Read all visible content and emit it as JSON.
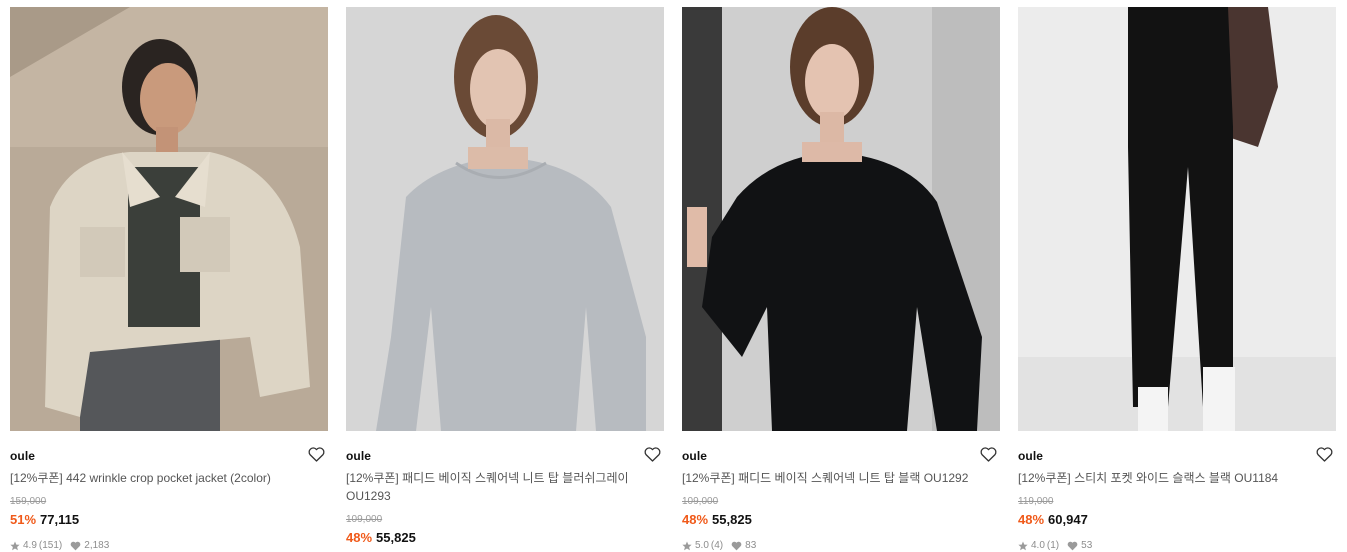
{
  "products": [
    {
      "brand": "oule",
      "title": "[12%쿠폰] 442 wrinkle crop pocket jacket (2color)",
      "original_price": "159,000",
      "discount": "51%",
      "sale_price": "77,115",
      "rating": "4.9",
      "reviews": "(151)",
      "likes": "2,183",
      "like_icon": "heart-outline-icon"
    },
    {
      "brand": "oule",
      "title": "[12%쿠폰] 패디드 베이직 스퀘어넥 니트 탑 블러쉬그레이 OU1293",
      "original_price": "109,000",
      "discount": "48%",
      "sale_price": "55,825",
      "like_icon": "heart-outline-icon"
    },
    {
      "brand": "oule",
      "title": "[12%쿠폰] 패디드 베이직 스퀘어넥 니트 탑 블랙 OU1292",
      "original_price": "109,000",
      "discount": "48%",
      "sale_price": "55,825",
      "rating": "5.0",
      "reviews": "(4)",
      "likes": "83",
      "like_icon": "heart-outline-icon"
    },
    {
      "brand": "oule",
      "title": "[12%쿠폰] 스티치 포켓 와이드 슬랙스 블랙 OU1184",
      "original_price": "119,000",
      "discount": "48%",
      "sale_price": "60,947",
      "rating": "4.0",
      "reviews": "(1)",
      "likes": "53",
      "like_icon": "heart-outline-icon"
    }
  ],
  "colors": {
    "discount": "#f05a1a",
    "original_price": "#9a9a9a",
    "meta": "#8d8d8d"
  }
}
